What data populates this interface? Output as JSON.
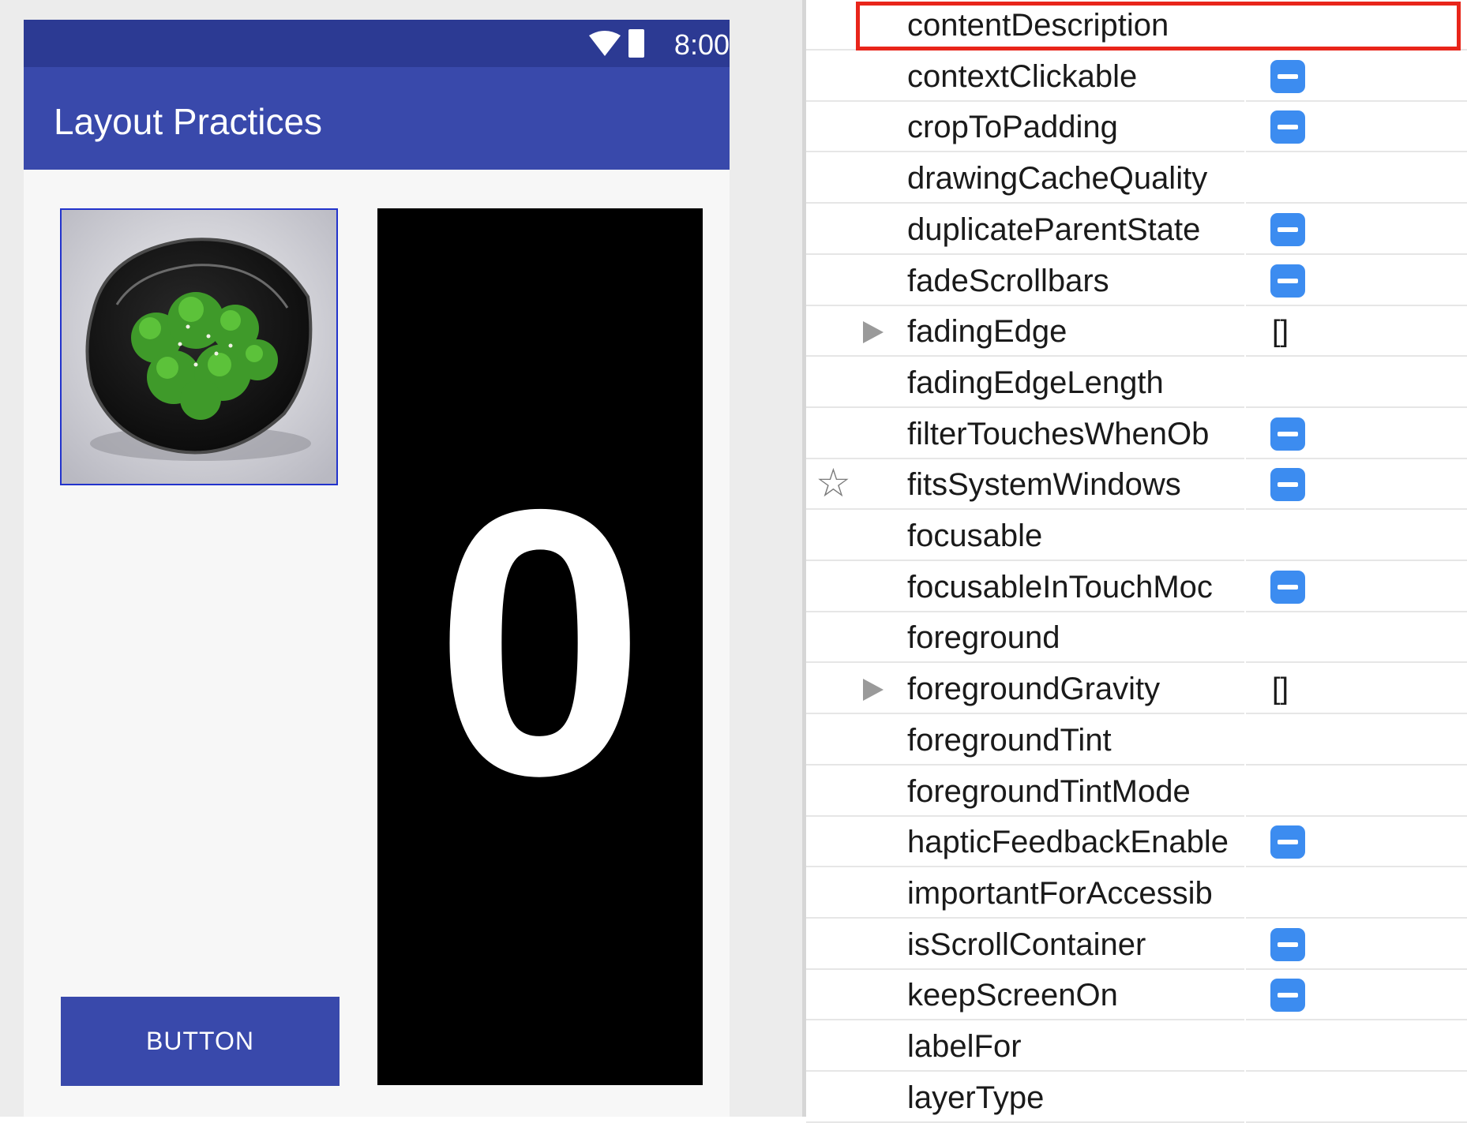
{
  "device": {
    "status_bar": {
      "time": "8:00",
      "icons": [
        "wifi-icon",
        "battery-icon"
      ]
    },
    "app_bar": {
      "title": "Layout Practices"
    },
    "image": {
      "description_icon": "broccoli-bowl-image"
    },
    "counter": {
      "value": "0"
    },
    "button": {
      "label": "BUTTON"
    }
  },
  "inspector": {
    "highlighted_attribute": "contentDescription",
    "attributes": [
      {
        "name": "contentDescription",
        "control": "none"
      },
      {
        "name": "contextClickable",
        "control": "toggle"
      },
      {
        "name": "cropToPadding",
        "control": "toggle"
      },
      {
        "name": "drawingCacheQuality",
        "control": "none"
      },
      {
        "name": "duplicateParentState",
        "control": "toggle"
      },
      {
        "name": "fadeScrollbars",
        "control": "toggle"
      },
      {
        "name": "fadingEdge",
        "control": "value",
        "value": "[]",
        "expandable": true
      },
      {
        "name": "fadingEdgeLength",
        "control": "none"
      },
      {
        "name": "filterTouchesWhenOb",
        "control": "toggle"
      },
      {
        "name": "fitsSystemWindows",
        "control": "toggle",
        "starred": true
      },
      {
        "name": "focusable",
        "control": "none"
      },
      {
        "name": "focusableInTouchMoc",
        "control": "toggle"
      },
      {
        "name": "foreground",
        "control": "none"
      },
      {
        "name": "foregroundGravity",
        "control": "value",
        "value": "[]",
        "expandable": true
      },
      {
        "name": "foregroundTint",
        "control": "none"
      },
      {
        "name": "foregroundTintMode",
        "control": "none"
      },
      {
        "name": "hapticFeedbackEnable",
        "control": "toggle"
      },
      {
        "name": "importantForAccessib",
        "control": "none"
      },
      {
        "name": "isScrollContainer",
        "control": "toggle"
      },
      {
        "name": "keepScreenOn",
        "control": "toggle"
      },
      {
        "name": "labelFor",
        "control": "none"
      },
      {
        "name": "layerType",
        "control": "none"
      }
    ]
  },
  "colors": {
    "status_bar": "#2c3a93",
    "primary": "#3949ab",
    "toggle": "#3c8cf0",
    "highlight": "#e8251a"
  }
}
